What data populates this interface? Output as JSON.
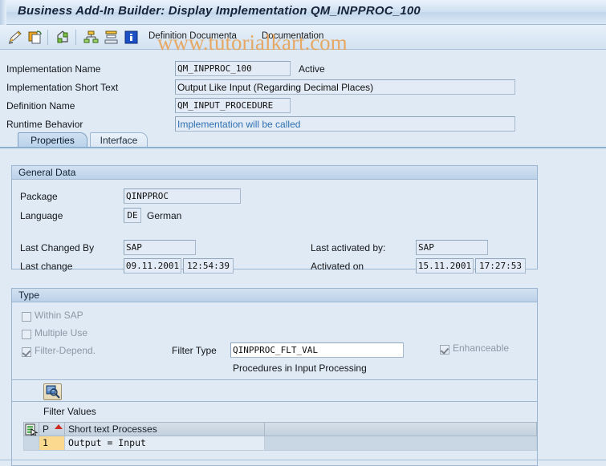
{
  "window": {
    "title": "Business Add-In Builder: Display Implementation QM_INPPROC_100"
  },
  "toolbar": {
    "icons": [
      {
        "name": "edit-pencil-icon",
        "glyph": "✎"
      },
      {
        "name": "copy-icon",
        "glyph": "❐"
      },
      {
        "name": "display-object-icon",
        "glyph": "❖"
      },
      {
        "name": "hierarchy-icon",
        "glyph": "⛓"
      },
      {
        "name": "stack-icon",
        "glyph": "≡"
      },
      {
        "name": "information-icon",
        "glyph": "i"
      }
    ],
    "definition_documentation_label": "Definition Documenta",
    "documentation_label": "Documentation"
  },
  "watermark": {
    "text": "www.tutorialkart.com"
  },
  "header": {
    "implementation_name_label": "Implementation Name",
    "implementation_name_value": "QM_INPPROC_100",
    "implementation_status": "Active",
    "short_text_label": "Implementation Short Text",
    "short_text_value": "Output Like Input (Regarding Decimal Places)",
    "definition_name_label": "Definition Name",
    "definition_name_value": "QM_INPUT_PROCEDURE",
    "runtime_behavior_label": "Runtime Behavior",
    "runtime_behavior_value": "Implementation will be called"
  },
  "tabs": [
    {
      "label": "Properties",
      "active": true
    },
    {
      "label": "Interface",
      "active": false
    }
  ],
  "general_data": {
    "title": "General Data",
    "package_label": "Package",
    "package_value": "QINPPROC",
    "language_label": "Language",
    "language_code": "DE",
    "language_text": "German",
    "last_changed_by_label": "Last Changed By",
    "last_changed_by_value": "SAP",
    "last_change_label": "Last change",
    "last_change_date": "09.11.2001",
    "last_change_time": "12:54:39",
    "last_activated_by_label": "Last activated by:",
    "last_activated_by_value": "SAP",
    "activated_on_label": "Activated on",
    "activated_on_date": "15.11.2001",
    "activated_on_time": "17:27:53"
  },
  "type_section": {
    "title": "Type",
    "within_sap_label": "Within SAP",
    "multiple_use_label": "Multiple Use",
    "filter_depend_label": "Filter-Depend.",
    "filter_type_label": "Filter Type",
    "filter_type_value": "QINPPROC_FLT_VAL",
    "filter_type_description": "Procedures in Input Processing",
    "enhanceable_label": "Enhanceable",
    "filter_values_label": "Filter Values"
  },
  "filter_grid": {
    "columns": [
      "P",
      "Short text Processes"
    ],
    "sort_column": "P",
    "rows": [
      {
        "p": "1",
        "short_text": "Output = Input"
      }
    ]
  }
}
